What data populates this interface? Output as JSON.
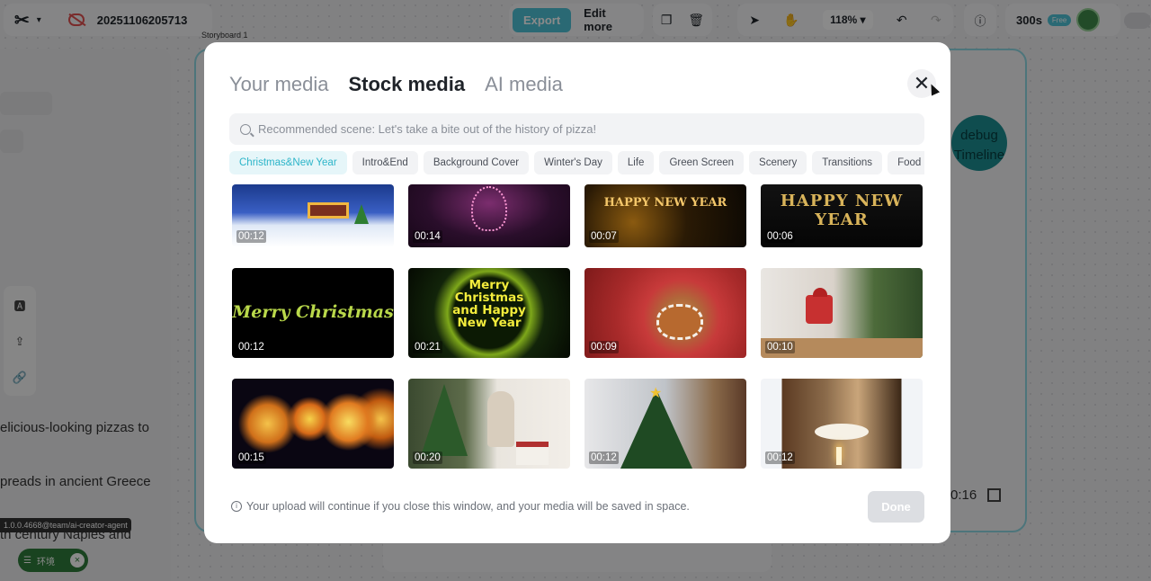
{
  "topbar": {
    "project_name": "20251106205713",
    "export_label": "Export",
    "edit_more_label": "Edit more",
    "zoom": "118%",
    "credits": "300s",
    "free_badge": "Free"
  },
  "background": {
    "storyboard_label": "Storyboard 1",
    "debug_label": "debug Timeline",
    "text_lines": [
      "elicious-looking pizzas to",
      "preads in ancient Greece",
      "th century Naples and"
    ],
    "time": "0:16",
    "version_tag": "1.0.0.4668@team/ai-creator-agent",
    "env_label": "环境"
  },
  "modal": {
    "tabs": [
      {
        "label": "Your media",
        "active": false
      },
      {
        "label": "Stock media",
        "active": true
      },
      {
        "label": "AI media",
        "active": false
      }
    ],
    "search": {
      "placeholder": "Recommended scene: Let's take a bite out of the history of pizza!",
      "value": ""
    },
    "categories": [
      {
        "label": "Christmas&New Year",
        "active": true
      },
      {
        "label": "Intro&End",
        "active": false
      },
      {
        "label": "Background Cover",
        "active": false
      },
      {
        "label": "Winter's Day",
        "active": false
      },
      {
        "label": "Life",
        "active": false
      },
      {
        "label": "Green Screen",
        "active": false
      },
      {
        "label": "Scenery",
        "active": false
      },
      {
        "label": "Transitions",
        "active": false
      },
      {
        "label": "Food",
        "active": false
      }
    ],
    "media": [
      {
        "duration": "00:12",
        "scene": "snowy-house-night"
      },
      {
        "duration": "00:14",
        "scene": "pink-spiral-tree"
      },
      {
        "duration": "00:07",
        "scene": "golden-bokeh-text",
        "caption": "HAPPY NEW YEAR"
      },
      {
        "duration": "00:06",
        "scene": "gold-glitter-text",
        "caption": "HAPPY NEW YEAR"
      },
      {
        "duration": "00:12",
        "scene": "glowing-script",
        "caption": "Merry Christmas"
      },
      {
        "duration": "00:21",
        "scene": "green-sparkle-ring",
        "caption": "Merry Christmas and Happy New Year"
      },
      {
        "duration": "00:09",
        "scene": "gingerbread-cookies"
      },
      {
        "duration": "00:10",
        "scene": "child-opening-gifts"
      },
      {
        "duration": "00:15",
        "scene": "fireworks"
      },
      {
        "duration": "00:20",
        "scene": "woman-wrapping-gifts"
      },
      {
        "duration": "00:12",
        "scene": "decorated-tree-window"
      },
      {
        "duration": "00:12",
        "scene": "holiday-dinner-table"
      }
    ],
    "footer_note": "Your upload will continue if you close this window, and your media will be saved in space.",
    "done_label": "Done"
  }
}
